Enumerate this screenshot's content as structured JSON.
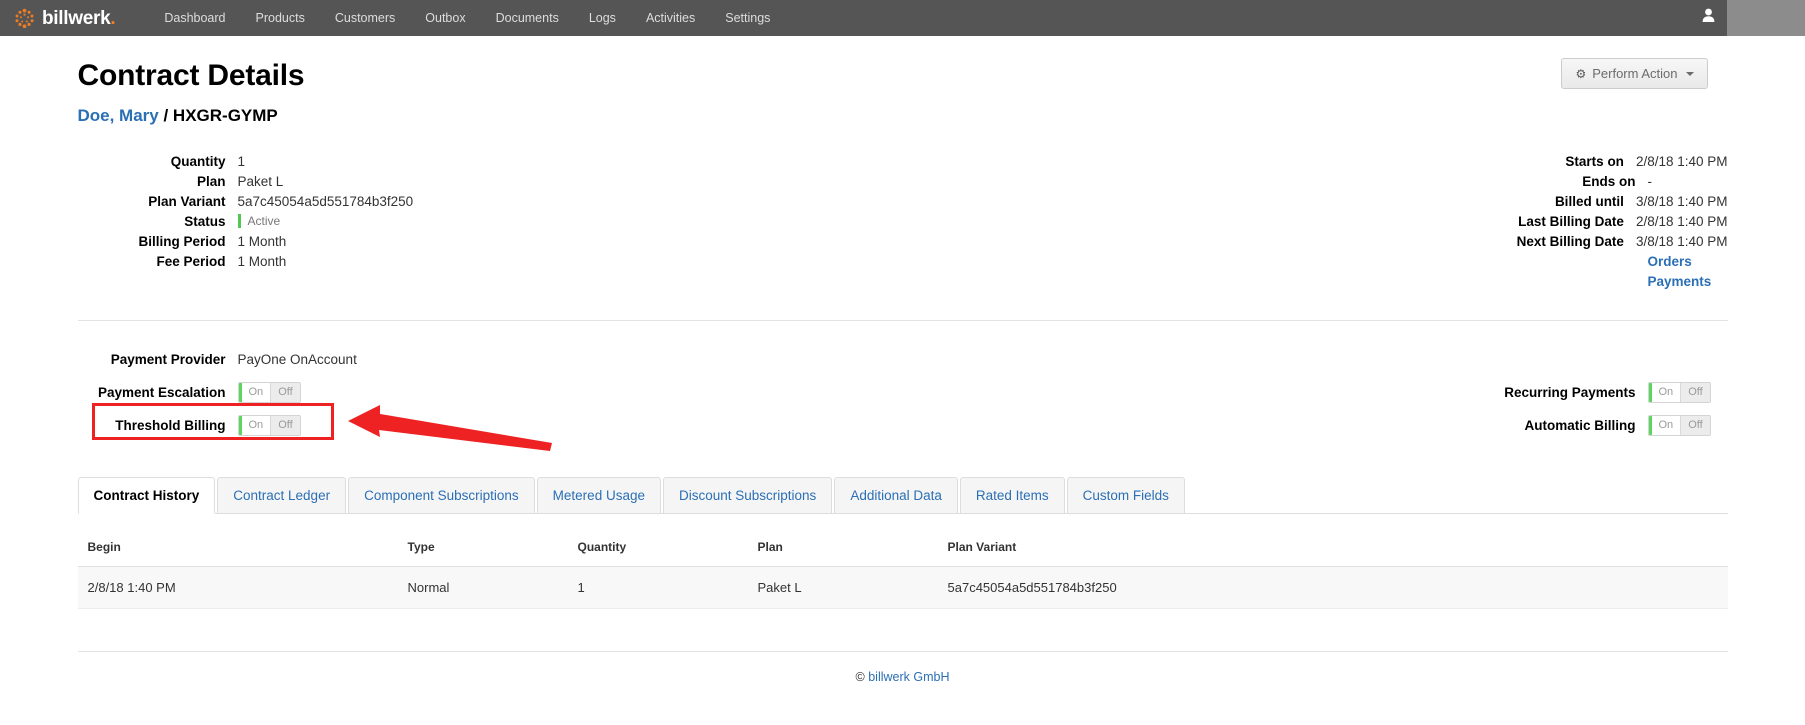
{
  "navbar": {
    "brand": "billwerk",
    "brand_dot": ".",
    "logo_icon": "billwerk-dots-logo-icon",
    "links": [
      {
        "label": "Dashboard"
      },
      {
        "label": "Products"
      },
      {
        "label": "Customers"
      },
      {
        "label": "Outbox"
      },
      {
        "label": "Documents"
      },
      {
        "label": "Logs"
      },
      {
        "label": "Activities"
      },
      {
        "label": "Settings"
      }
    ],
    "user_icon": "user-avatar-icon"
  },
  "header": {
    "title": "Contract Details",
    "customer_link": "Doe, Mary",
    "separator": " / ",
    "contract_code": "HXGR-GYMP",
    "perform_action_label": "Perform Action",
    "perform_action_icon": "gear-icon"
  },
  "details_left": [
    {
      "label": "Quantity",
      "value": "1"
    },
    {
      "label": "Plan",
      "value": "Paket L"
    },
    {
      "label": "Plan Variant",
      "value": "5a7c45054a5d551784b3f250"
    },
    {
      "label": "Status",
      "value": "Active"
    },
    {
      "label": "Billing Period",
      "value": "1 Month"
    },
    {
      "label": "Fee Period",
      "value": "1 Month"
    }
  ],
  "details_right": [
    {
      "label": "Starts on",
      "value": "2/8/18 1:40 PM"
    },
    {
      "label": "Ends on",
      "value": "-"
    },
    {
      "label": "Billed until",
      "value": "3/8/18 1:40 PM"
    },
    {
      "label": "Last Billing Date",
      "value": "2/8/18 1:40 PM"
    },
    {
      "label": "Next Billing Date",
      "value": "3/8/18 1:40 PM"
    }
  ],
  "detail_links": [
    {
      "label": "Orders"
    },
    {
      "label": "Payments"
    }
  ],
  "payments": {
    "provider_label": "Payment Provider",
    "provider_value": "PayOne OnAccount",
    "escalation_label": "Payment Escalation",
    "threshold_label": "Threshold Billing",
    "recurring_label": "Recurring Payments",
    "automatic_label": "Automatic Billing",
    "toggle_on": "On",
    "toggle_off": "Off",
    "escalation_state": "Off",
    "threshold_state": "Off",
    "recurring_state": "Off",
    "automatic_state": "Off"
  },
  "annotation": {
    "highlight_color": "#ee2222",
    "arrow_icon": "red-arrow-pointing-left"
  },
  "tabs": [
    {
      "label": "Contract History",
      "active": true
    },
    {
      "label": "Contract Ledger",
      "active": false
    },
    {
      "label": "Component Subscriptions",
      "active": false
    },
    {
      "label": "Metered Usage",
      "active": false
    },
    {
      "label": "Discount Subscriptions",
      "active": false
    },
    {
      "label": "Additional Data",
      "active": false
    },
    {
      "label": "Rated Items",
      "active": false
    },
    {
      "label": "Custom Fields",
      "active": false
    }
  ],
  "history_table": {
    "columns": [
      "Begin",
      "Type",
      "Quantity",
      "Plan",
      "Plan Variant"
    ],
    "rows": [
      {
        "begin": "2/8/18 1:40 PM",
        "type": "Normal",
        "quantity": "1",
        "plan": "Paket L",
        "plan_variant": "5a7c45054a5d551784b3f250"
      }
    ]
  },
  "footer": {
    "copyright": "©",
    "company": "billwerk GmbH"
  }
}
